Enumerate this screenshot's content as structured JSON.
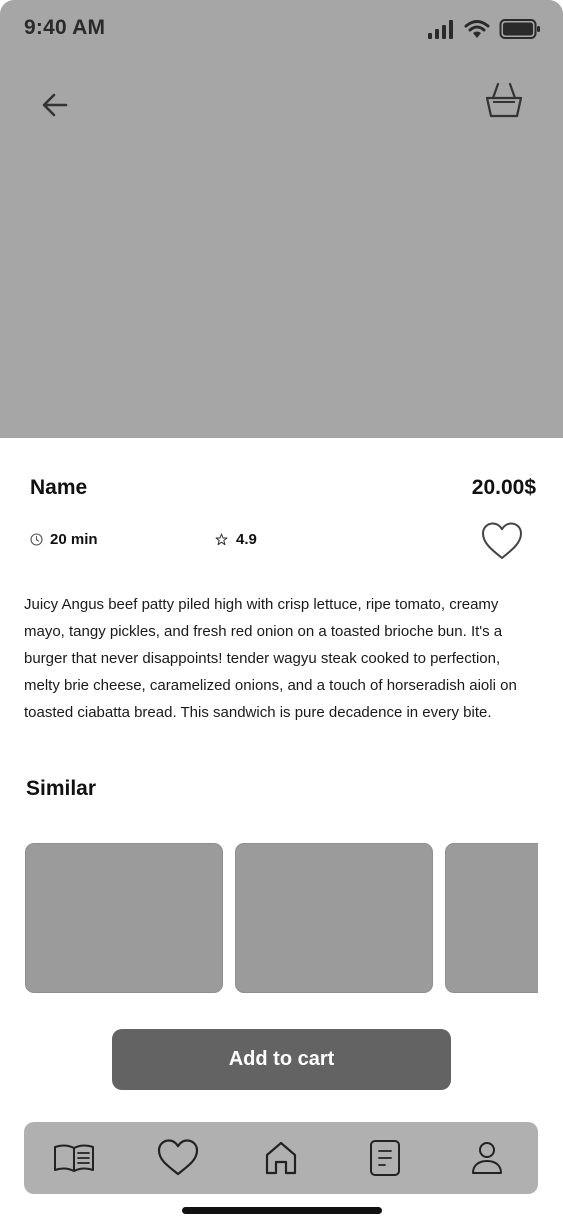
{
  "status_bar": {
    "time": "9:40 AM",
    "icons": [
      "cellular-signal-icon",
      "wifi-icon",
      "battery-icon"
    ]
  },
  "top_nav": {
    "back_icon": "arrow-left-icon",
    "cart_icon": "basket-icon"
  },
  "product": {
    "name": "Name",
    "price": "20.00$",
    "time": "20 min",
    "rating": "4.9",
    "description": "Juicy Angus beef patty piled high with crisp lettuce, ripe tomato, creamy mayo, tangy pickles, and fresh red onion on a toasted brioche bun. It's a burger that never disappoints! tender wagyu steak cooked to perfection, melty brie cheese, caramelized onions, and a touch of horseradish aioli on toasted ciabatta bread. This sandwich is pure decadence in every bite."
  },
  "similar": {
    "title": "Similar"
  },
  "actions": {
    "add_to_cart": "Add to cart"
  },
  "tab_bar": {
    "items": [
      {
        "icon": "menu-book-icon"
      },
      {
        "icon": "heart-icon"
      },
      {
        "icon": "home-icon"
      },
      {
        "icon": "orders-list-icon"
      },
      {
        "icon": "profile-icon"
      }
    ]
  },
  "colors": {
    "hero_placeholder": "#a6a6a6",
    "card_placeholder": "#9b9b9b",
    "primary_button": "#636363",
    "tab_bar": "#b0b0b0"
  }
}
